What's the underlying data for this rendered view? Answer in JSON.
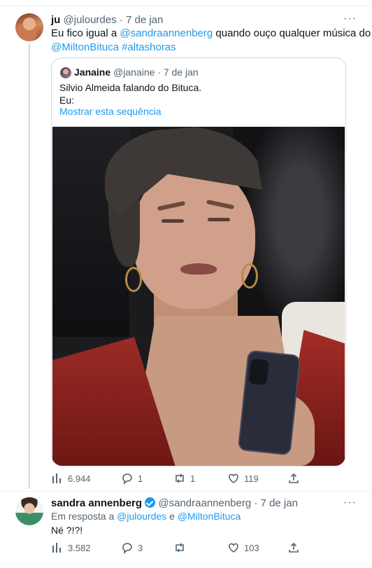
{
  "tweet1": {
    "name": "ju",
    "handle": "@julourdes",
    "sep": "·",
    "date": "7 de jan",
    "more": "···",
    "text_prefix": "Eu fico igual a ",
    "mention": "@sandraannenberg",
    "text_mid": " quando ouço qualquer música do",
    "mention2": "@MiltonBituca",
    "hashtag": "#altashoras",
    "quote": {
      "name": "Janaine",
      "handle": "@janaine",
      "date": "7 de jan",
      "line1": "Silvio Almeida falando do Bituca.",
      "line2": "Eu:",
      "show_thread": "Mostrar esta sequência"
    },
    "stats": {
      "views": "6.944",
      "replies": "1",
      "retweets": "1",
      "likes": "119"
    }
  },
  "tweet2": {
    "name": "sandra annenberg",
    "handle": "@sandraannenberg",
    "sep": "·",
    "date": "7 de jan",
    "more": "···",
    "reply_prefix": "Em resposta a ",
    "reply_user1": "@julourdes",
    "reply_and": " e ",
    "reply_user2": "@MiltonBituca",
    "text": "Né ?!?!",
    "stats": {
      "views": "3.582",
      "replies": "3",
      "retweets": "",
      "likes": "103"
    }
  },
  "colors": {
    "accent": "#1d9bf0",
    "muted": "#536471",
    "border": "#cfd9de"
  }
}
